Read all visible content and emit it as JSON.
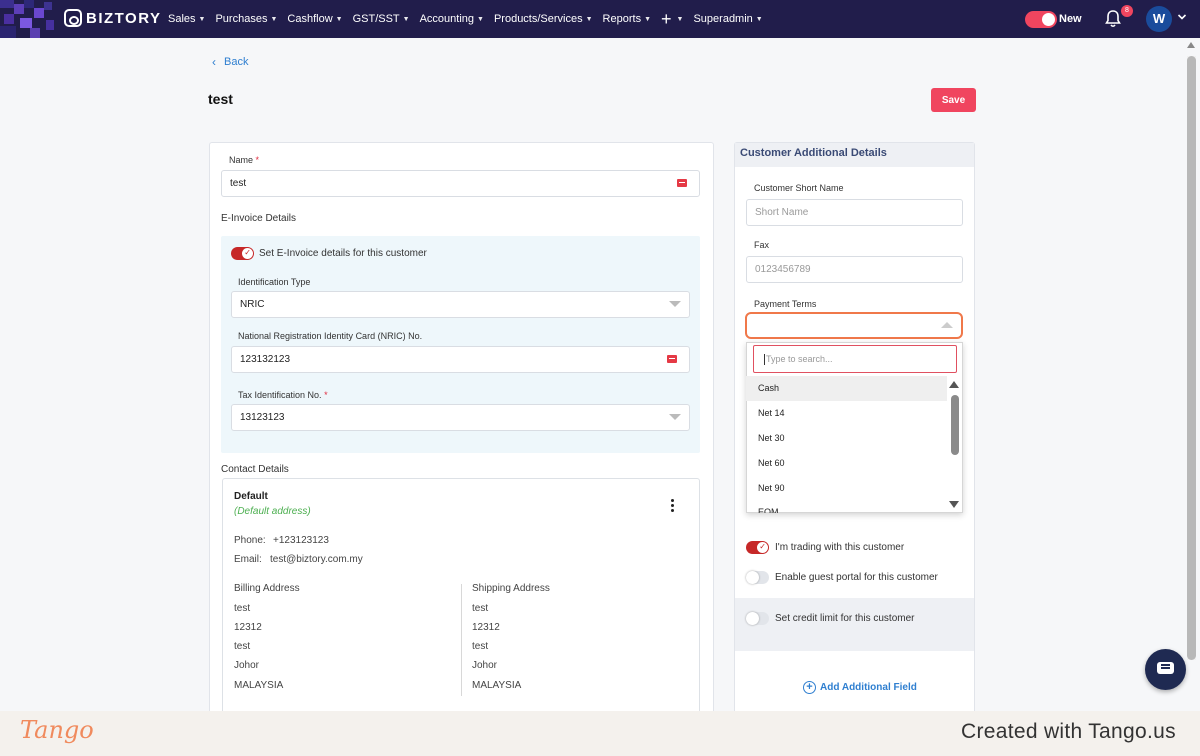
{
  "nav": {
    "brand": "BIZTORY",
    "items": [
      {
        "label": "Sales"
      },
      {
        "label": "Purchases"
      },
      {
        "label": "Cashflow"
      },
      {
        "label": "GST/SST"
      },
      {
        "label": "Accounting"
      },
      {
        "label": "Products/Services"
      },
      {
        "label": "Reports"
      }
    ],
    "plus": "+",
    "superadmin": "Superadmin",
    "new_label": "New",
    "bell_badge": "8",
    "avatar_letter": "W"
  },
  "page": {
    "back": "Back",
    "title": "test",
    "save": "Save"
  },
  "left": {
    "name_label": "Name",
    "name_req": "*",
    "name_value": "test",
    "einvoice_heading": "E-Invoice Details",
    "einvoice_toggle": "Set E-Invoice details for this customer",
    "id_type_label": "Identification Type",
    "id_type_value": "NRIC",
    "nric_label": "National Registration Identity Card (NRIC) No.",
    "nric_value": "123132123",
    "tin_label": "Tax Identification No.",
    "tin_req": "*",
    "tin_value": "13123123",
    "contact_heading": "Contact Details",
    "contact": {
      "title": "Default",
      "subtitle": "(Default address)",
      "phone_label": "Phone:",
      "phone": "+123123123",
      "email_label": "Email:",
      "email": "test@biztory.com.my",
      "billing_label": "Billing Address",
      "shipping_label": "Shipping Address",
      "billing": [
        "test",
        "12312",
        "test",
        "Johor",
        "MALAYSIA"
      ],
      "shipping": [
        "test",
        "12312",
        "test",
        "Johor",
        "MALAYSIA"
      ]
    }
  },
  "right": {
    "title": "Customer Additional Details",
    "short_name_label": "Customer Short Name",
    "short_name_placeholder": "Short Name",
    "fax_label": "Fax",
    "fax_placeholder": "0123456789",
    "payment_terms_label": "Payment Terms",
    "search_placeholder": "Type to search...",
    "options": [
      "Cash",
      "Net 14",
      "Net 30",
      "Net 60",
      "Net 90",
      "EOM"
    ],
    "trading_label": "I'm trading with this customer",
    "guest_portal_label": "Enable guest portal for this customer",
    "credit_limit_label": "Set credit limit for this customer",
    "add_field": "Add Additional Field"
  },
  "footer": {
    "logo": "Tango",
    "created": "Created with Tango.us"
  },
  "colors": {
    "nav_bg": "#211d4b",
    "accent": "#f0455f",
    "link": "#2f7fd0",
    "highlight": "#f0784a"
  }
}
